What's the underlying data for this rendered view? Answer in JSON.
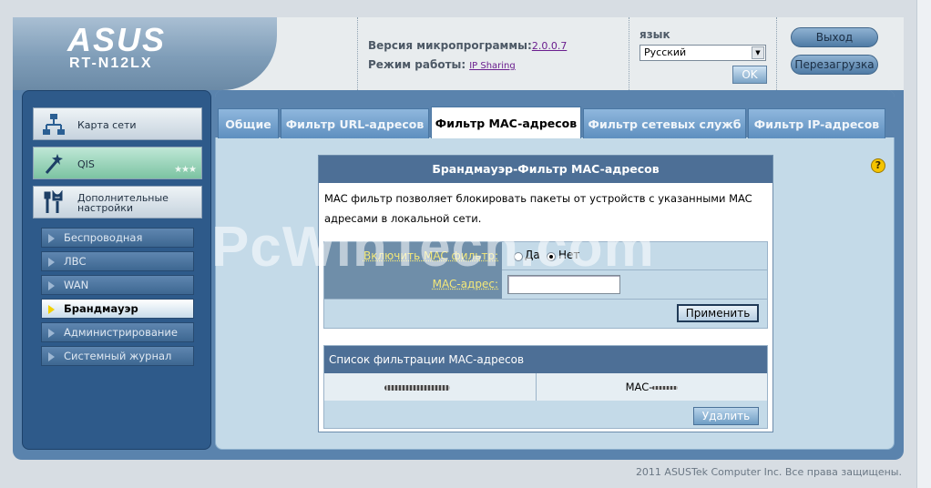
{
  "header": {
    "brand": "ASUS",
    "model": "RT-N12LX",
    "firmware_label": "Версия микропрограммы:",
    "firmware_value": "2.0.0.7",
    "mode_label": "Режим работы:",
    "mode_value": "IP Sharing",
    "language_label": "язык",
    "language_selected": "Русский",
    "ok_label": "OK",
    "logout_label": "Выход",
    "reboot_label": "Перезагрузка"
  },
  "sidebar": {
    "big_items": [
      {
        "label": "Карта сети",
        "icon": "network-map-icon"
      },
      {
        "label": "QIS",
        "icon": "magic-wand-icon"
      },
      {
        "label": "Дополнительные настройки",
        "icon": "tools-icon"
      }
    ],
    "qis_stars": "★★★",
    "sub_items": [
      {
        "label": "Беспроводная"
      },
      {
        "label": "ЛВС"
      },
      {
        "label": "WAN"
      },
      {
        "label": "Брандмауэр",
        "active": true
      },
      {
        "label": "Администрирование"
      },
      {
        "label": "Системный журнал"
      }
    ]
  },
  "tabs": [
    {
      "label": "Общие"
    },
    {
      "label": "Фильтр URL-адресов"
    },
    {
      "label": "Фильтр MAC-адресов",
      "active": true
    },
    {
      "label": "Фильтр сетевых служб"
    },
    {
      "label": "Фильтр IP-адресов"
    }
  ],
  "help_glyph": "?",
  "form": {
    "title": "Брандмауэр-Фильтр MAC-адресов",
    "description": "MAC фильтр позволяет блокировать пакеты от устройств с указанными MAC адресами в локальной сети.",
    "enable_label": "Включить MAC фильтр:",
    "radio_yes": "Да",
    "radio_no": "Нет",
    "enable_value": "Нет",
    "mac_label": "MAC-адрес:",
    "mac_value": "",
    "apply_label": "Применить",
    "list_title": "Список фильтрации MAC-адресов",
    "list_col2_prefix": "MAC-",
    "delete_label": "Удалить"
  },
  "watermark": "PcWinTech.com",
  "footer": "2011 ASUSTek Computer Inc. Все права защищены.",
  "colors": {
    "accent": "#4d6f96",
    "sidebar": "#2e5a8a",
    "label_yellow": "#f4e879"
  }
}
